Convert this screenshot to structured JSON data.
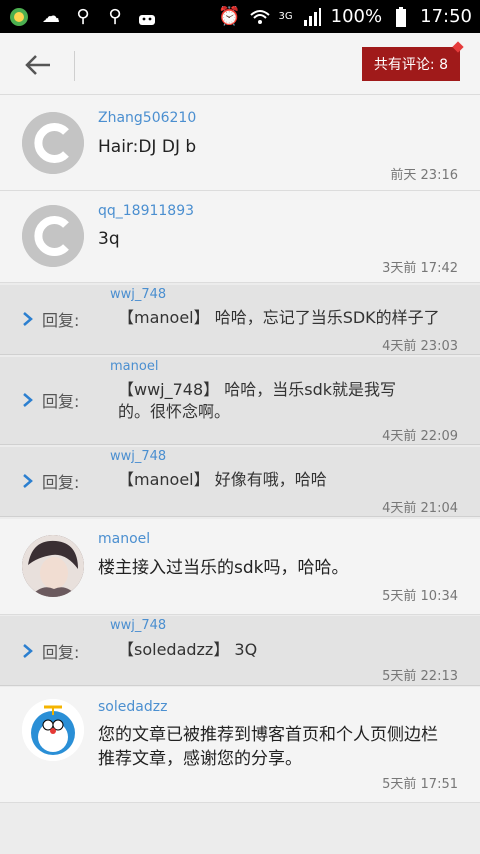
{
  "status_bar": {
    "network": "3G",
    "battery": "100%",
    "time": "17:50"
  },
  "header": {
    "comment_count_label": "共有评论: 8"
  },
  "reply_label": "回复:",
  "items": [
    {
      "kind": "comment",
      "author": "Zhang506210",
      "text": "Hair:DJ DJ b",
      "time": "前天 23:16",
      "avatar": "c-logo"
    },
    {
      "kind": "comment",
      "author": "qq_18911893",
      "text": "3q",
      "time": "3天前 17:42",
      "avatar": "c-logo"
    },
    {
      "kind": "reply",
      "author": "wwj_748",
      "text": "【manoel】 哈哈，忘记了当乐SDK的样子了",
      "time": "4天前 23:03"
    },
    {
      "kind": "reply",
      "author": "manoel",
      "text": "【wwj_748】 哈哈，当乐sdk就是我写的。很怀念啊。",
      "time": "4天前 22:09"
    },
    {
      "kind": "reply",
      "author": "wwj_748",
      "text": "【manoel】 好像有哦，哈哈",
      "time": "4天前 21:04"
    },
    {
      "kind": "comment",
      "author": "manoel",
      "text": "楼主接入过当乐的sdk吗，哈哈。",
      "time": "5天前 10:34",
      "avatar": "photo"
    },
    {
      "kind": "reply",
      "author": "wwj_748",
      "text": "【soledadzz】 3Q",
      "time": "5天前 22:13"
    },
    {
      "kind": "comment",
      "author": "soledadzz",
      "text": "您的文章已被推荐到博客首页和个人页侧边栏推荐文章，感谢您的分享。",
      "time": "5天前 17:51",
      "avatar": "doraemon"
    }
  ]
}
